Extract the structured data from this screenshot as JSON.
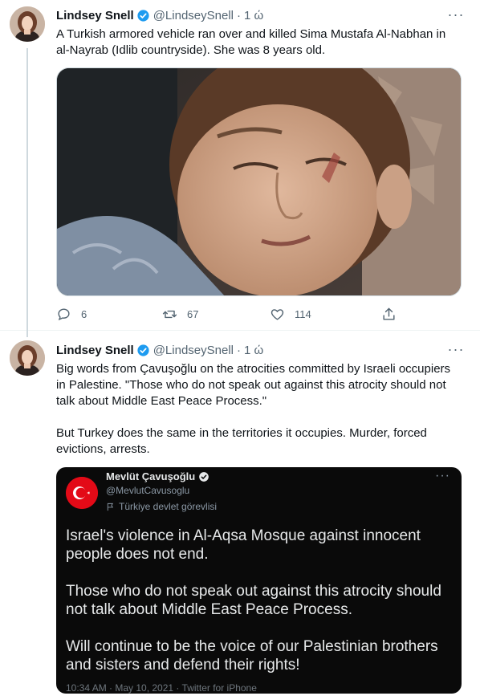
{
  "tweets": [
    {
      "author": {
        "name": "Lindsey Snell",
        "handle": "@LindseySnell",
        "verified": true
      },
      "time": "1 ώ",
      "more_label": "···",
      "text": "A Turkish armored vehicle ran over and killed Sima Mustafa Al-Nabhan in al-Nayrab (Idlib countryside). She was 8 years old.",
      "media": {
        "type": "photo"
      },
      "actions": {
        "replies": "6",
        "retweets": "67",
        "likes": "114"
      }
    },
    {
      "author": {
        "name": "Lindsey Snell",
        "handle": "@LindseySnell",
        "verified": true
      },
      "time": "1 ώ",
      "more_label": "···",
      "text_p1": "Big words from Çavuşoğlu on the atrocities committed by Israeli occupiers in Palestine. \"Those who do not speak out against this atrocity should not talk about Middle East Peace Process.\"",
      "text_p2": "But Turkey does the same in the territories it occupies. Murder, forced evictions, arrests.",
      "quoted": {
        "name": "Mevlüt Çavuşoğlu",
        "handle": "@MevlutCavusoglu",
        "label": "Türkiye devlet görevlisi",
        "more_label": "···",
        "p1": "Israel's violence in Al-Aqsa Mosque against innocent people does not end.",
        "p2": "Those who do not speak out against this atrocity should not talk about Middle East Peace Process.",
        "p3": "Will continue to be the voice of our Palestinian brothers and sisters and defend their rights!",
        "footer": "10:34 AM · May 10, 2021 · Twitter for iPhone"
      }
    }
  ],
  "colors": {
    "accent": "#1d9bf0",
    "text": "#0f1419",
    "muted": "#536471",
    "quote_bg": "#0a0a0a",
    "flag_red": "#e30a17"
  },
  "icons": [
    "reply-icon",
    "retweet-icon",
    "like-icon",
    "share-icon",
    "verified-badge-icon",
    "more-icon",
    "government-label-icon"
  ]
}
